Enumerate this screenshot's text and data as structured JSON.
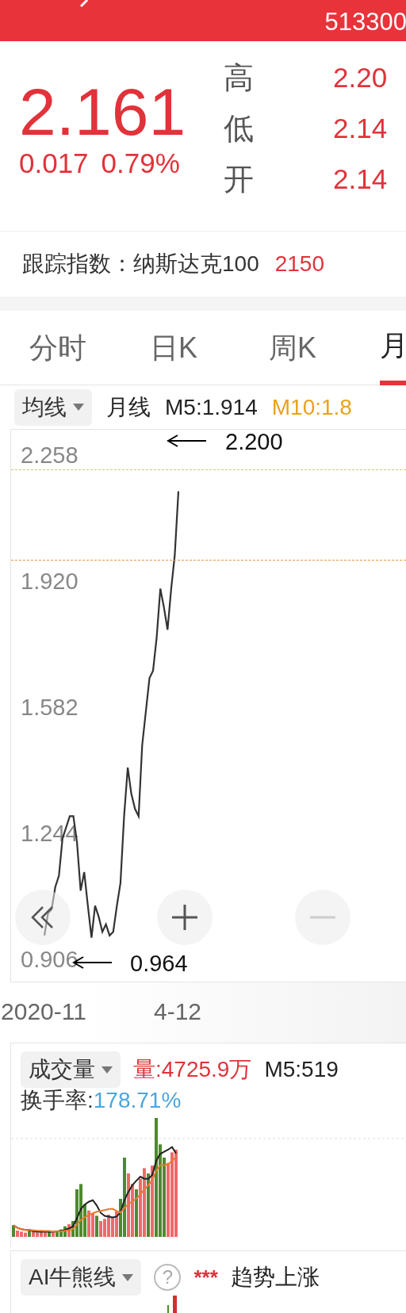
{
  "header": {
    "code": "513300"
  },
  "quote": {
    "price": "2.161",
    "change": "0.017",
    "change_pct": "0.79%",
    "stats": [
      {
        "label": "高",
        "value": "2.20"
      },
      {
        "label": "低",
        "value": "2.14"
      },
      {
        "label": "开",
        "value": "2.14"
      }
    ]
  },
  "tracking": {
    "label": "跟踪指数：纳斯达克100",
    "value": "2150"
  },
  "tabs": [
    {
      "label": "分时",
      "selected": false
    },
    {
      "label": "日K",
      "selected": false
    },
    {
      "label": "周K",
      "selected": false
    },
    {
      "label": "月",
      "selected": true
    }
  ],
  "indicator_bar": {
    "dropdown": "均线",
    "ma": [
      {
        "label": "M5:1.914",
        "color": "#222222"
      },
      {
        "label": "M10:1.8",
        "color": "#e8a21e"
      }
    ]
  },
  "price_chart": {
    "chart_data": {
      "type": "line",
      "ylim": [
        0.906,
        2.258
      ],
      "categories": [
        "2020-11",
        null,
        null,
        null,
        null,
        null,
        null,
        null,
        null,
        null,
        null,
        null,
        null,
        null,
        null,
        null,
        null,
        null,
        null,
        null,
        null,
        null,
        null,
        null,
        null,
        null,
        null,
        null,
        null,
        null,
        null,
        null,
        null,
        null,
        null,
        null,
        null,
        "4-12",
        null,
        null,
        null,
        null,
        null,
        null,
        null,
        null,
        null,
        null,
        null,
        null,
        null,
        null,
        null,
        null,
        null,
        null,
        null,
        null,
        null,
        null,
        null,
        null,
        null,
        null,
        null,
        null,
        null,
        null,
        null,
        null,
        null,
        null,
        null,
        null,
        null,
        null,
        null,
        null,
        null,
        null,
        null,
        null,
        null,
        null,
        null,
        null,
        null,
        null,
        null
      ],
      "yticks": [
        {
          "value": 2.258,
          "label": "2.258"
        },
        {
          "value": 1.92,
          "label": "1.920"
        },
        {
          "value": 1.582,
          "label": "1.582"
        },
        {
          "value": 1.244,
          "label": "1.244"
        },
        {
          "value": 0.906,
          "label": "0.906"
        }
      ],
      "series": [
        {
          "name": "月线",
          "color": "#333333",
          "values": [
            0.97,
            1.03,
            1.04,
            1.1,
            1.13,
            1.23,
            1.26,
            1.29,
            1.29,
            1.22,
            1.09,
            1.14,
            1.05,
            0.964,
            1.05,
            1.02,
            0.98,
            1.0,
            0.97,
            0.98,
            1.05,
            1.11,
            1.29,
            1.42,
            1.35,
            1.31,
            1.29,
            1.48,
            1.57,
            1.66,
            1.68,
            1.77,
            1.9,
            1.85,
            1.79,
            1.9,
            1.99,
            2.161,
            null,
            null,
            null,
            null,
            null,
            null,
            null,
            null,
            null,
            null,
            null,
            null,
            null,
            null,
            null,
            null,
            null,
            null,
            null,
            null,
            null,
            null,
            null,
            null,
            null,
            null,
            null,
            null,
            null,
            null,
            null,
            null,
            null,
            null,
            null,
            null,
            null,
            null,
            null,
            null,
            null,
            null,
            null,
            null,
            null,
            null,
            null,
            null,
            null,
            null,
            null
          ]
        }
      ],
      "annotations": [
        {
          "text": "2.200"
        },
        {
          "text": "0.964"
        }
      ]
    }
  },
  "volume": {
    "dropdown": "成交量",
    "volume": "量:4725.9万",
    "ma5": "M5:519",
    "turnover_label": "换手率:",
    "turnover_value": "178.71%"
  },
  "ai": {
    "dropdown": "AI牛熊线",
    "help": "?",
    "marks": "***",
    "signal": "趋势上涨"
  }
}
